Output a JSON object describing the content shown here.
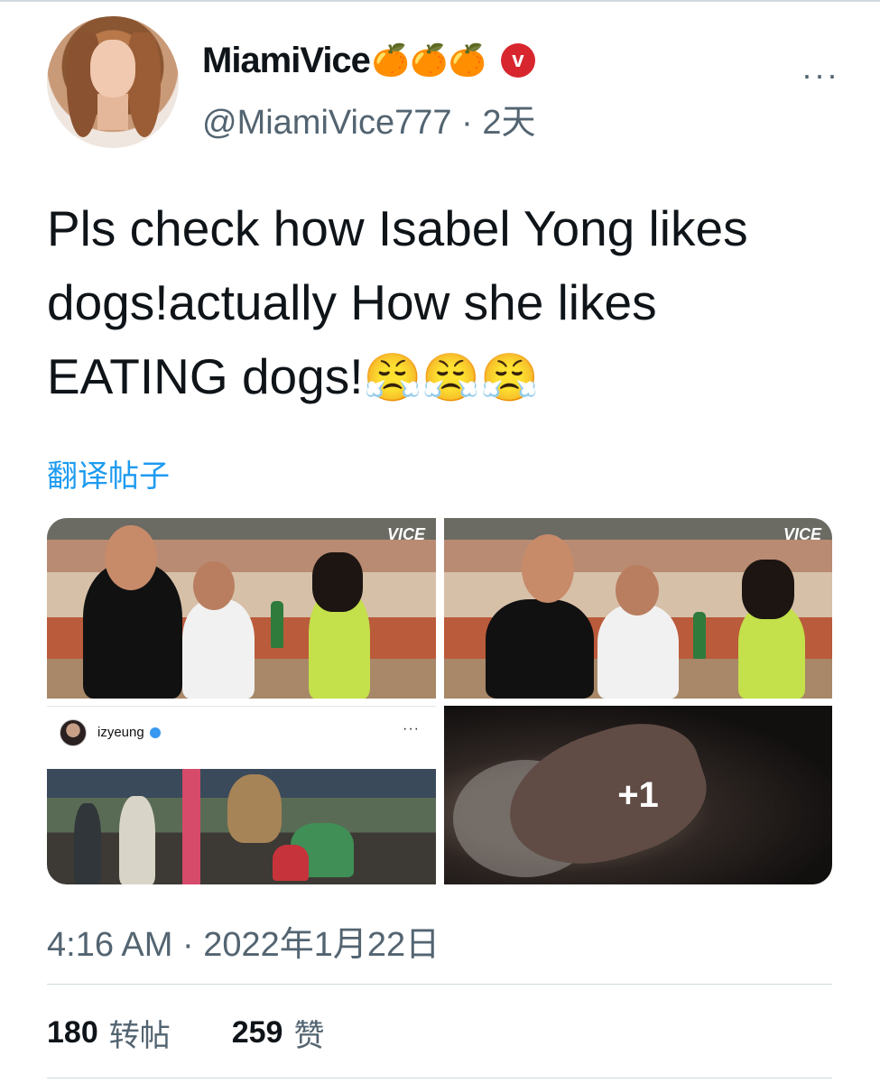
{
  "tweet": {
    "author": {
      "display_name": "MiamiVice",
      "name_emojis": "🍊🍊🍊",
      "badge_letter": "v",
      "handle": "@MiamiVice777",
      "separator": "·",
      "age": "2天"
    },
    "text_lines": [
      "Pls check how Isabel Yong likes",
      "dogs!actually How she likes",
      "EATING dogs!"
    ],
    "text_emojis": "😤😤😤",
    "translate_label": "翻译帖子",
    "media": {
      "cells": [
        {
          "kind": "video-still",
          "tag": "VICE"
        },
        {
          "kind": "video-still",
          "tag": "VICE"
        },
        {
          "kind": "instagram-post",
          "username": "izyeung",
          "more": "···"
        },
        {
          "kind": "photo",
          "overflow_label": "+1"
        }
      ]
    },
    "timestamp": "4:16 AM · 2022年1月22日",
    "stats": {
      "retweets_count": "180",
      "retweets_label": "转帖",
      "likes_count": "259",
      "likes_label": "赞"
    },
    "more_label": "···"
  },
  "colors": {
    "text": "#0f1419",
    "secondary": "#536471",
    "link": "#1d9bf0",
    "badge": "#d8262e",
    "divider": "#cfd9de"
  },
  "icons": [
    "more-options-icon",
    "verified-badge-icon",
    "instagram-verified-icon"
  ]
}
